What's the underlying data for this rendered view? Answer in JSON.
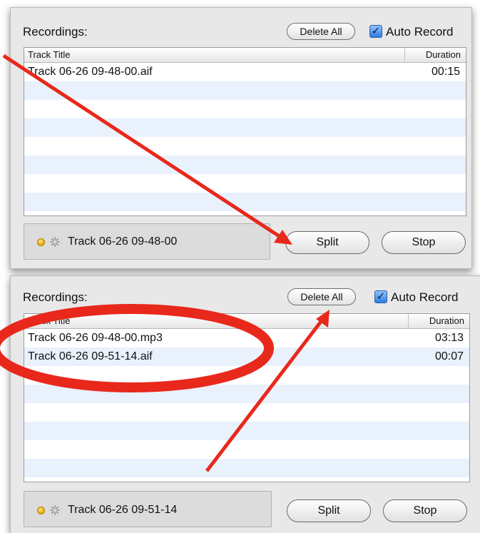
{
  "panels": [
    {
      "recordings_label": "Recordings:",
      "delete_all_label": "Delete All",
      "auto_record_label": "Auto Record",
      "auto_record_checked": true,
      "columns": {
        "title": "Track Title",
        "duration": "Duration"
      },
      "rows": [
        {
          "title": "Track 06-26 09-48-00.aif",
          "duration": "00:15"
        },
        {
          "title": "",
          "duration": ""
        },
        {
          "title": "",
          "duration": ""
        },
        {
          "title": "",
          "duration": ""
        },
        {
          "title": "",
          "duration": ""
        },
        {
          "title": "",
          "duration": ""
        },
        {
          "title": "",
          "duration": ""
        },
        {
          "title": "",
          "duration": ""
        }
      ],
      "status_text": "Track 06-26 09-48-00",
      "split_label": "Split",
      "stop_label": "Stop"
    },
    {
      "recordings_label": "Recordings:",
      "delete_all_label": "Delete All",
      "auto_record_label": "Auto Record",
      "auto_record_checked": true,
      "columns": {
        "title": "Track Title",
        "duration": "Duration"
      },
      "rows": [
        {
          "title": "Track 06-26 09-48-00.mp3",
          "duration": "03:13"
        },
        {
          "title": "Track 06-26 09-51-14.aif",
          "duration": "00:07"
        },
        {
          "title": "",
          "duration": ""
        },
        {
          "title": "",
          "duration": ""
        },
        {
          "title": "",
          "duration": ""
        },
        {
          "title": "",
          "duration": ""
        },
        {
          "title": "",
          "duration": ""
        },
        {
          "title": "",
          "duration": ""
        }
      ],
      "status_text": "Track 06-26 09-51-14",
      "split_label": "Split",
      "stop_label": "Stop"
    }
  ],
  "annotation_color": "#e8281b",
  "check_glyph": "✓"
}
